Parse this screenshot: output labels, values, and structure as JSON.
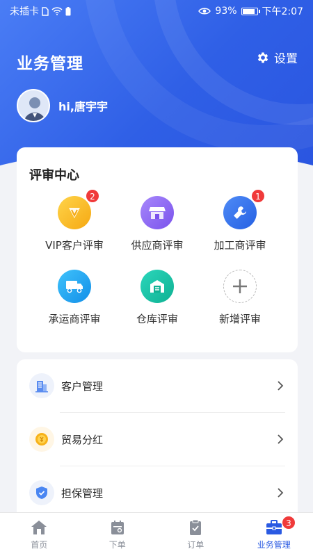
{
  "status_bar": {
    "carrier": "未插卡",
    "battery": "93%",
    "battery_level": 0.93,
    "time": "下午2:07"
  },
  "header": {
    "title": "业务管理",
    "settings_label": "设置"
  },
  "user": {
    "greeting": "hi,唐宇宇"
  },
  "review_center": {
    "title": "评审中心",
    "items": [
      {
        "label": "VIP客户评审",
        "icon": "vip-icon",
        "color": "#f7b21a",
        "badge": "2"
      },
      {
        "label": "供应商评审",
        "icon": "store-icon",
        "color": "#8a62f0",
        "badge": null
      },
      {
        "label": "加工商评审",
        "icon": "wrench-icon",
        "color": "#2f6fe8",
        "badge": "1"
      },
      {
        "label": "承运商评审",
        "icon": "truck-icon",
        "color": "#1aa3ef",
        "badge": null
      },
      {
        "label": "仓库评审",
        "icon": "warehouse-icon",
        "color": "#14c1a6",
        "badge": null
      },
      {
        "label": "新增评审",
        "icon": "plus-icon",
        "color": "#bbbbbb",
        "badge": null
      }
    ]
  },
  "menu": {
    "items": [
      {
        "label": "客户管理",
        "icon": "building-icon"
      },
      {
        "label": "贸易分红",
        "icon": "coin-icon"
      },
      {
        "label": "担保管理",
        "icon": "shield-icon"
      }
    ]
  },
  "tabbar": {
    "tabs": [
      {
        "label": "首页",
        "icon": "home-icon",
        "active": false
      },
      {
        "label": "下单",
        "icon": "calendar-icon",
        "active": false
      },
      {
        "label": "订单",
        "icon": "clipboard-check-icon",
        "active": false
      },
      {
        "label": "业务管理",
        "icon": "briefcase-icon",
        "active": true,
        "badge": "3"
      }
    ]
  },
  "colors": {
    "primary": "#2a5ae2",
    "badge": "#f03a3a"
  }
}
